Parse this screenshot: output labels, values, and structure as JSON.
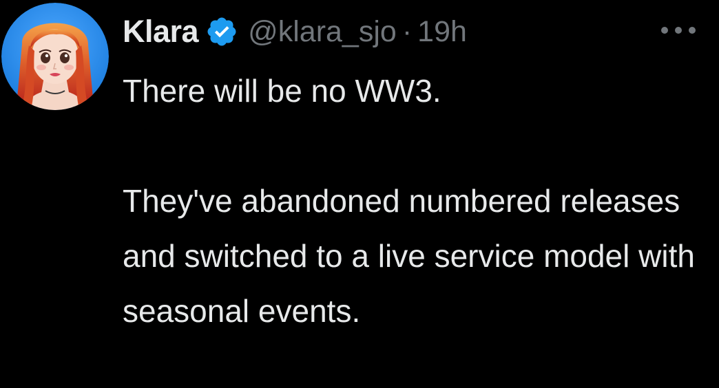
{
  "colors": {
    "background": "#000000",
    "primary_text": "#e7e9ea",
    "secondary_text": "#71767b",
    "verified_badge": "#1d9bf0"
  },
  "tweet": {
    "author": {
      "display_name": "Klara",
      "handle": "@klara_sjo",
      "verified": true,
      "avatar_icon": "avatar-illustration-red-haired-woman"
    },
    "separator": "·",
    "timestamp": "19h",
    "more_icon": "more-options-icon",
    "text": {
      "paragraph_1": "There will be no WW3.",
      "paragraph_2": "They've abandoned numbered releases and switched to a live service model with seasonal events."
    }
  }
}
